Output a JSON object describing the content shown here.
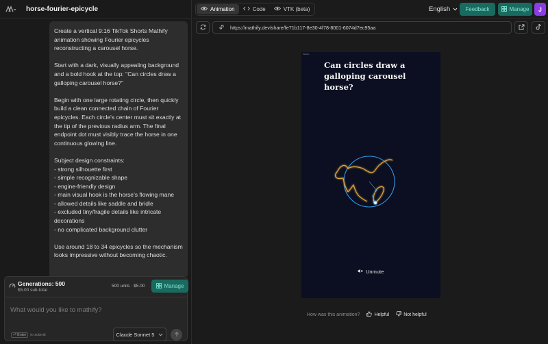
{
  "sidebar": {
    "project_name": "horse-fourier-epicycle",
    "prompt_message": "Create a vertical 9:16 TikTok Shorts Mathify animation showing Fourier epicycles reconstructing a carousel horse.\n\nStart with a dark, visually appealing background and a bold hook at the top: \"Can circles draw a galloping carousel horse?\"\n\nBegin with one large rotating circle, then quickly build a clean connected chain of Fourier epicycles. Each circle's center must sit exactly at the tip of the previous radius arm. The final endpoint dot must visibly trace the horse in one continuous glowing line.\n\nSubject design constraints:\n- strong silhouette first\n- simple recognizable shape\n- engine-friendly design\n- main visual hook is the horse's flowing mane\n- allowed details like saddle and bridle\n- excluded tiny/fragile details like intricate decorations\n- no complicated background clutter\n\nUse around 18 to 34 epicycles so the mechanism looks impressive without becoming chaotic."
  },
  "generations": {
    "title": "Generations: 500",
    "subtotal": "$5.00 sub-total",
    "price": "500 units · $5.00",
    "manage_label": "Manage"
  },
  "composer": {
    "placeholder": "What would you like to mathify?",
    "enter_key": "Enter",
    "enter_hint": "to submit",
    "model": "Claude Sonnet 5"
  },
  "topbar": {
    "tabs": [
      {
        "label": "Animation",
        "icon": "eye-icon",
        "active": true
      },
      {
        "label": "Code",
        "icon": "code-icon",
        "active": false
      },
      {
        "label": "VTK (beta)",
        "icon": "eye-icon",
        "active": false
      }
    ],
    "language": "English",
    "feedback_label": "Feedback",
    "manage_label": "Manage",
    "avatar_initial": "J"
  },
  "url_bar": {
    "url": "https://mathify.dev/share/fe71b117-8e30-4f78-8001-6074d7ec95aa"
  },
  "video": {
    "watermark": "Mathify",
    "hook_text": "Can circles draw a galloping carousel horse?",
    "unmute_label": "Unmute"
  },
  "feedback": {
    "question": "How was this animation?",
    "helpful_label": "Helpful",
    "not_helpful_label": "Not helpful"
  },
  "colors": {
    "accent": "#1a6b5f",
    "accent_text": "#82e3d2",
    "avatar": "#8a3fe0",
    "video_bg": "#0b0f21",
    "circle": "#3aa6ff",
    "trace": "#e0a63a"
  }
}
